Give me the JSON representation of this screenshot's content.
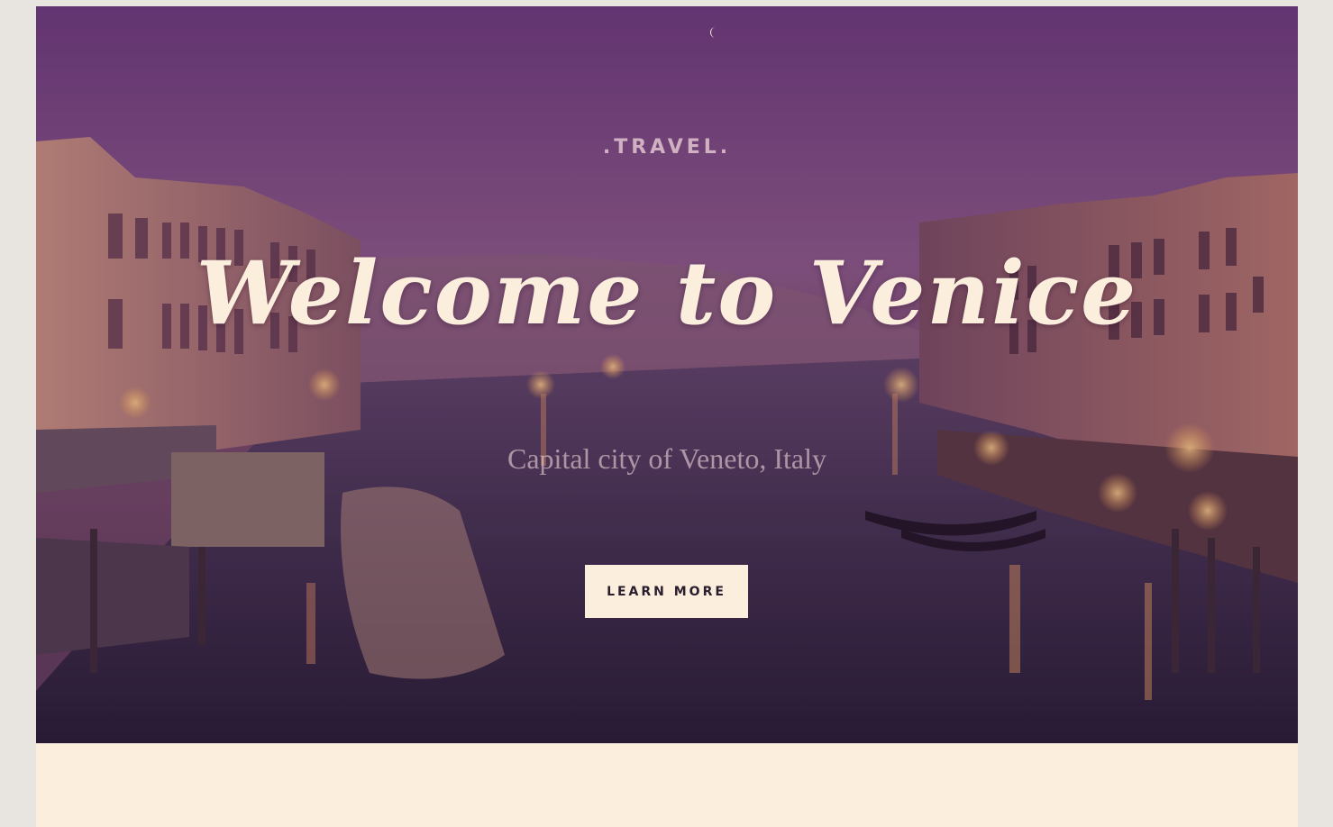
{
  "hero": {
    "eyebrow": ".TRAVEL.",
    "headline": "Welcome to Venice",
    "subtitle": "Capital city of Veneto, Italy",
    "cta_label": "LEARN MORE",
    "background_image": "venice-grand-canal-dusk",
    "moon_icon": "crescent-moon-icon"
  },
  "colors": {
    "page_background": "#e8e4df",
    "cream": "#fbeedd",
    "sky_purple": "#6a3a78",
    "button_text": "#2a1d2e"
  }
}
